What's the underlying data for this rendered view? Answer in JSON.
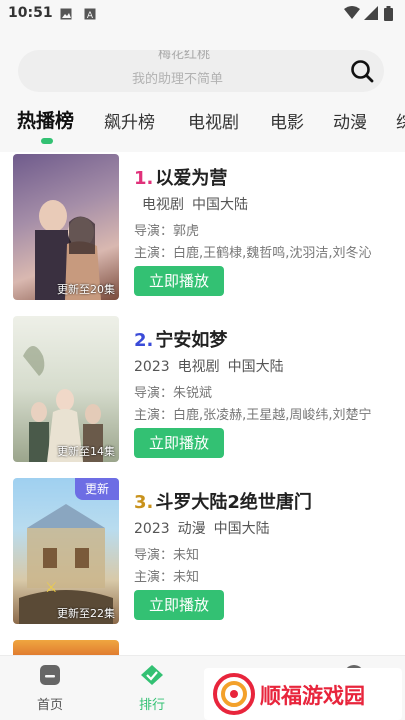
{
  "status_bar": {
    "time": "10:51"
  },
  "search": {
    "hint_top": "梅花红桃",
    "hint": "我的助理不简单"
  },
  "tabs": [
    "热播榜",
    "飙升榜",
    "电视剧",
    "电影",
    "动漫",
    "综"
  ],
  "items": [
    {
      "rank": "1.",
      "name": "以爱为营",
      "year": "",
      "type": "电视剧",
      "region": "中国大陆",
      "director": "导演：郭虎",
      "cast": "主演：白鹿,王鹤棣,魏哲鸣,沈羽洁,刘冬沁",
      "episodes": "更新至20集",
      "badge": "",
      "play_label": "立即播放",
      "rank_color": "#e0317a"
    },
    {
      "rank": "2.",
      "name": "宁安如梦",
      "year": "2023",
      "type": "电视剧",
      "region": "中国大陆",
      "director": "导演：朱锐斌",
      "cast": "主演：白鹿,张凌赫,王星越,周峻纬,刘楚宁",
      "episodes": "更新至14集",
      "badge": "",
      "play_label": "立即播放",
      "rank_color": "#3a4bd8"
    },
    {
      "rank": "3.",
      "name": "斗罗大陆2绝世唐门",
      "year": "2023",
      "type": "动漫",
      "region": "中国大陆",
      "director": "导演：未知",
      "cast": "主演：未知",
      "episodes": "更新至22集",
      "badge": "更新",
      "play_label": "立即播放",
      "rank_color": "#c8921c"
    }
  ],
  "bottom_nav": [
    {
      "label": "首页",
      "icon": "home-icon"
    },
    {
      "label": "排行",
      "icon": "ranking-icon"
    },
    {
      "label": "",
      "icon": "folder-icon"
    },
    {
      "label": "",
      "icon": "profile-icon"
    }
  ],
  "watermark": {
    "text": "顺福游戏园"
  },
  "colors": {
    "accent": "#33c173",
    "badge": "#6d6de4",
    "watermark": "#e8253c"
  }
}
